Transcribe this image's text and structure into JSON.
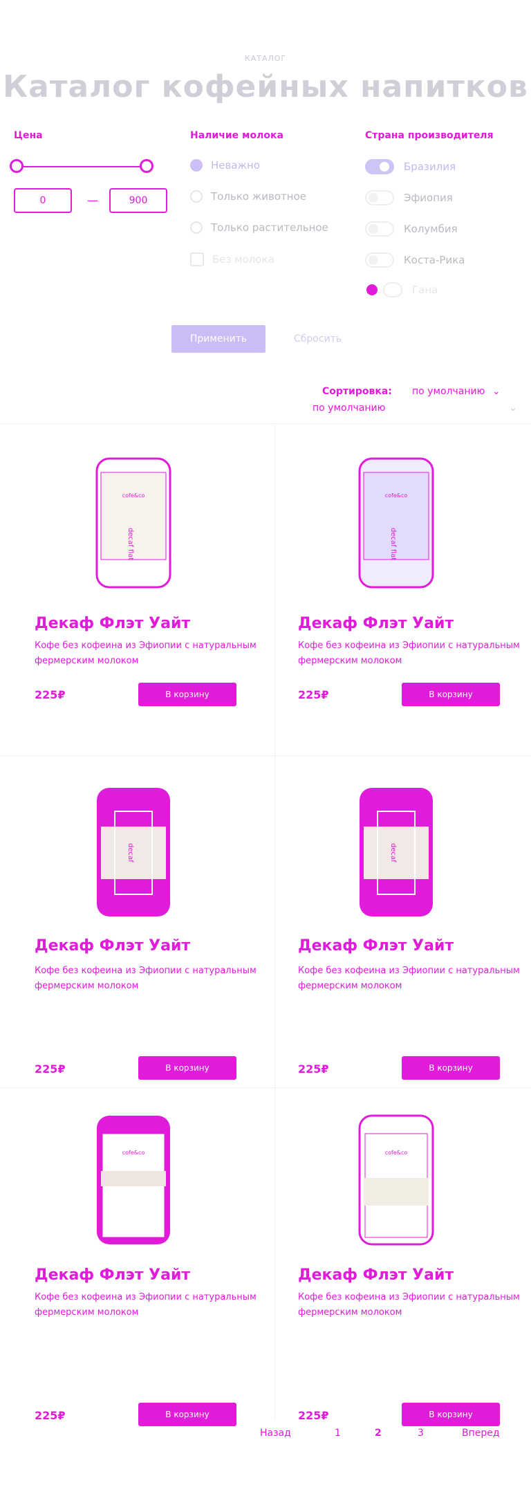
{
  "header": {
    "eyebrow": "КАТАЛОГ",
    "title": "Каталог кофейных напитков"
  },
  "filters": {
    "price": {
      "title": "Цена",
      "min_value": "0",
      "max_value": "900",
      "separator": "—"
    },
    "milk": {
      "title": "Наличие молока",
      "options": [
        {
          "label": "Неважно",
          "selected": true
        },
        {
          "label": "Только животное",
          "selected": false
        },
        {
          "label": "Только растительное",
          "selected": false
        },
        {
          "label": "Без молока",
          "selected": false
        }
      ]
    },
    "country": {
      "title": "Страна производителя",
      "options": [
        {
          "label": "Бразилия",
          "checked": true
        },
        {
          "label": "Эфиопия",
          "checked": false
        },
        {
          "label": "Колумбия",
          "checked": false
        },
        {
          "label": "Коста-Рика",
          "checked": false
        },
        {
          "label": "Гана",
          "checked": false
        }
      ]
    },
    "apply_label": "Применить",
    "reset_label": "Сбросить"
  },
  "sort": {
    "label": "Сортировка:",
    "value": "по умолчанию",
    "select_value": "по умолчанию"
  },
  "products": [
    {
      "name": "Декаф Флэт Уайт",
      "desc": "Кофе без кофеина из Эфиопии с натуральным фермерским молоком",
      "price": "225₽",
      "button": "В корзину"
    },
    {
      "name": "Декаф Флэт Уайт",
      "desc": "Кофе без кофеина из Эфиопии с натуральным фермерским молоком",
      "price": "225₽",
      "button": "В корзину"
    },
    {
      "name": "Декаф Флэт Уайт",
      "desc": "Кофе без кофеина из Эфиопии с натуральным фермерским молоком",
      "price": "225₽",
      "button": "В корзину"
    },
    {
      "name": "Декаф Флэт Уайт",
      "desc": "Кофе без кофеина из Эфиопии с натуральным фермерским молоком",
      "price": "225₽",
      "button": "В корзину"
    },
    {
      "name": "Декаф Флэт Уайт",
      "desc": "Кофе без кофеина из Эфиопии с натуральным фермерским молоком",
      "price": "225₽",
      "button": "В корзину"
    },
    {
      "name": "Декаф Флэт Уайт",
      "desc": "Кофе без кофеина из Эфиопии с натуральным фермерским молоком",
      "price": "225₽",
      "button": "В корзину"
    }
  ],
  "pagination": {
    "prev": "Назад",
    "pages": [
      "1",
      "2",
      "3"
    ],
    "next": "Вперед"
  },
  "colors": {
    "accent": "#e01bd9",
    "lavender": "#cbbcf5",
    "muted": "#cfcfd8"
  }
}
